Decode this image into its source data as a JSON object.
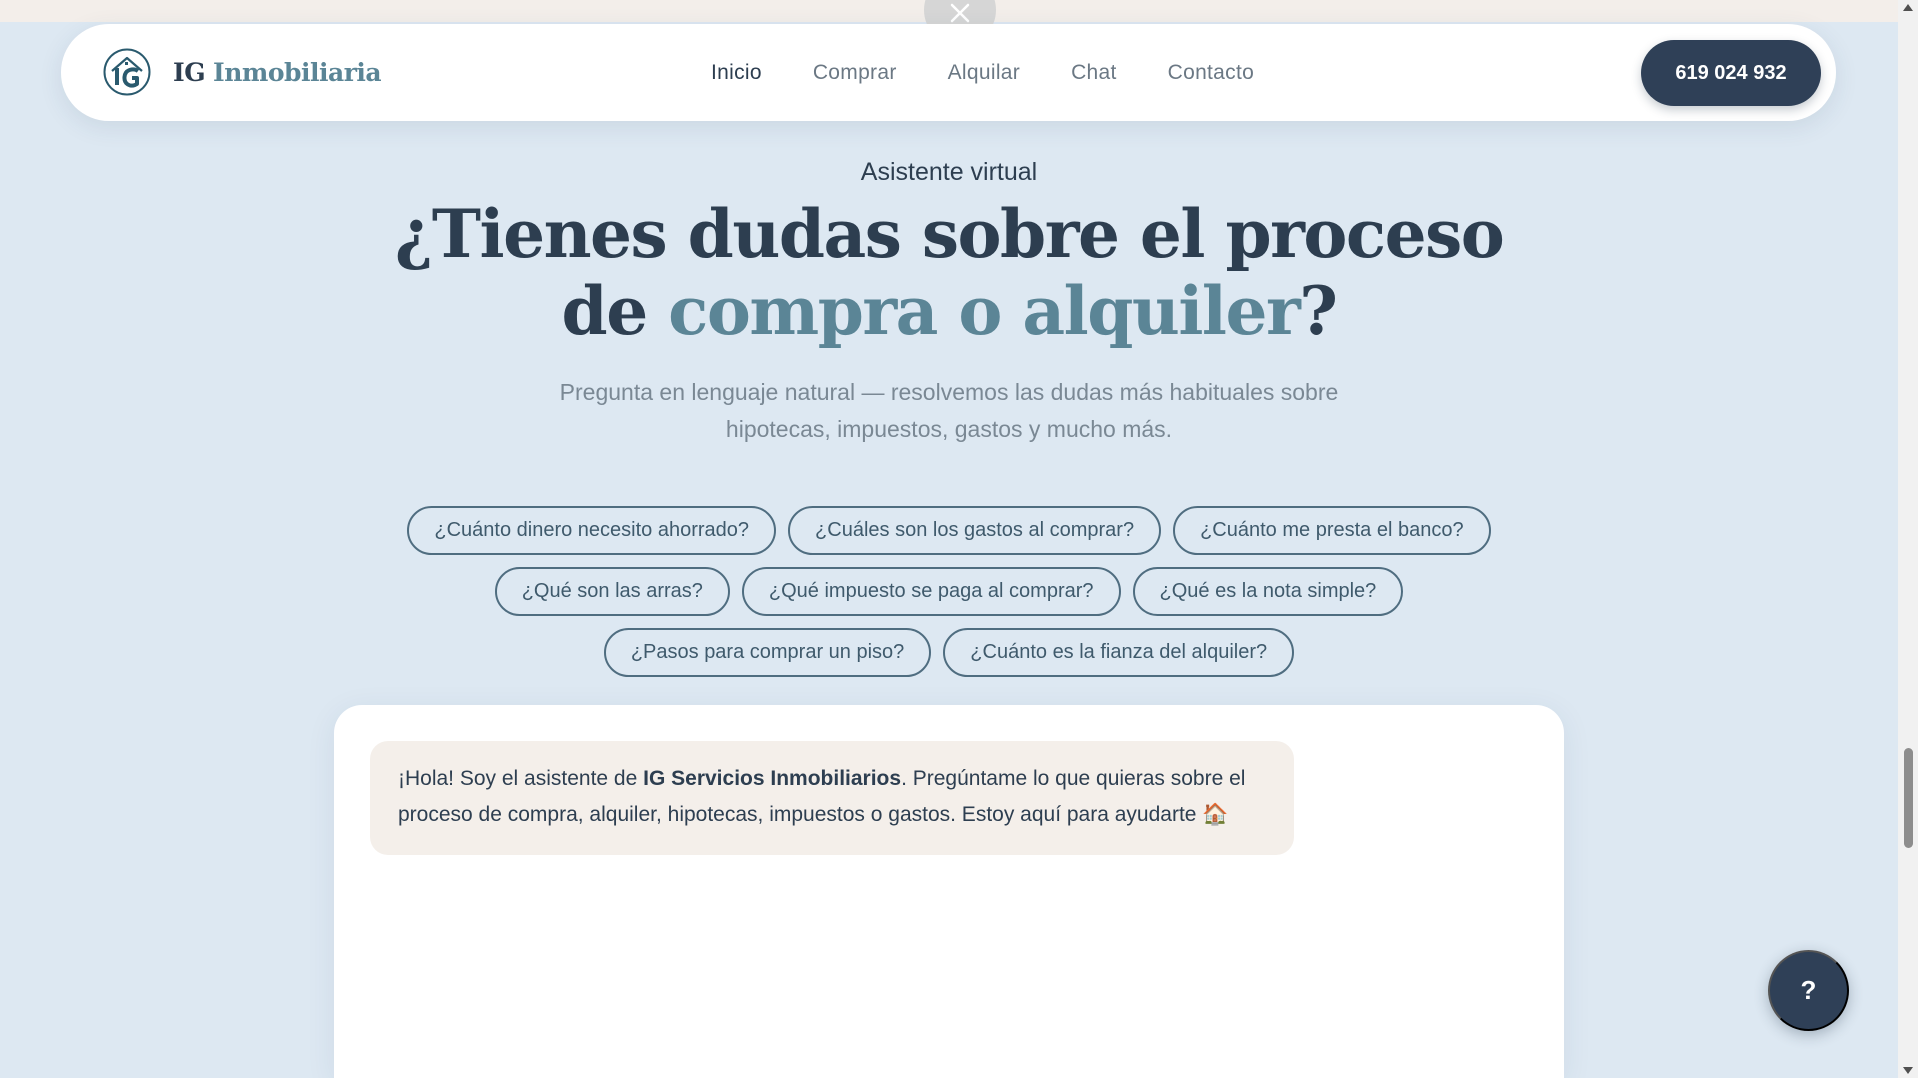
{
  "nav": {
    "brand_part1": "IG",
    "brand_part2": "Inmobiliaria",
    "logo_icon": "house-ig-logo-icon",
    "links": [
      {
        "label": "Inicio",
        "active": true
      },
      {
        "label": "Comprar",
        "active": false
      },
      {
        "label": "Alquilar",
        "active": false
      },
      {
        "label": "Chat",
        "active": false
      },
      {
        "label": "Contacto",
        "active": false
      }
    ],
    "phone": "619 024 932"
  },
  "hero": {
    "eyebrow": "Asistente virtual",
    "title_part1": "¿Tienes dudas sobre el proceso",
    "title_part2": "de",
    "title_accent": "compra o alquiler",
    "title_end": "?",
    "subtitle_line1": "Pregunta en lenguaje natural — resolvemos las dudas más habituales sobre",
    "subtitle_line2": "hipotecas, impuestos, gastos y mucho más."
  },
  "suggestions": [
    [
      "¿Cuánto dinero necesito ahorrado?",
      "¿Cuáles son los gastos al comprar?",
      "¿Cuánto me presta el banco?"
    ],
    [
      "¿Qué son las arras?",
      "¿Qué impuesto se paga al comprar?",
      "¿Qué es la nota simple?"
    ],
    [
      "¿Pasos para comprar un piso?",
      "¿Cuánto es la fianza del alquiler?"
    ]
  ],
  "chat": {
    "greeting_before": "¡Hola! Soy el asistente de ",
    "greeting_bold": "IG Servicios Inmobiliarios",
    "greeting_after": ". Pregúntame lo que quieras sobre el proceso de compra, alquiler, hipotecas, impuestos o gastos. Estoy aquí para ayudarte 🏠"
  },
  "help_button": "?",
  "colors": {
    "page_bg": "#dde8f2",
    "navy": "#2f4057",
    "accent": "#5b8596",
    "bubble_bg": "#f4efea"
  }
}
